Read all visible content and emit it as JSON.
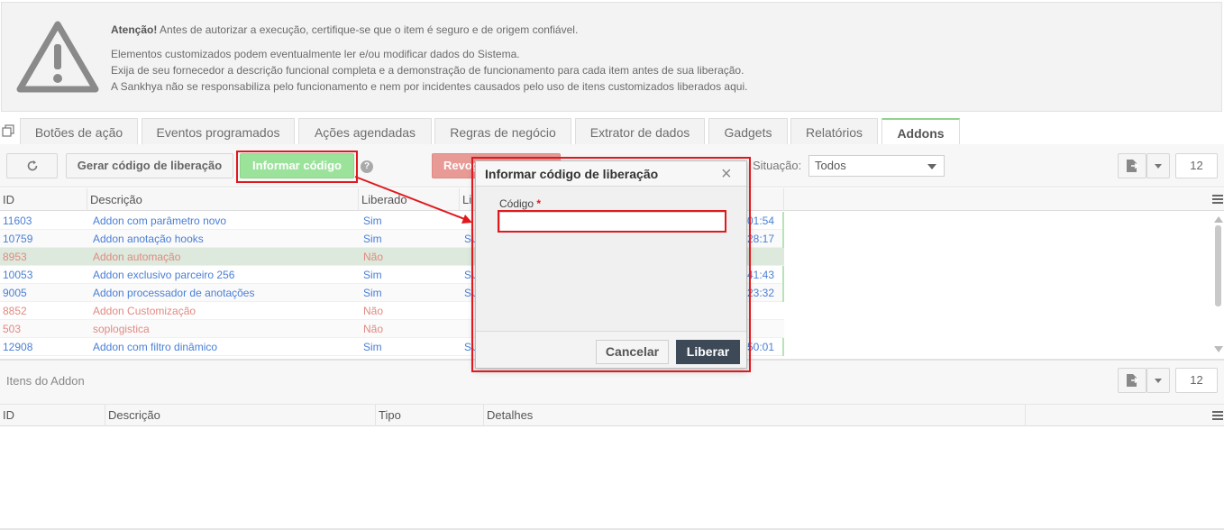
{
  "warning": {
    "bold": "Atenção!",
    "line1": " Antes de autorizar a execução, certifique-se que o item é seguro e de origem confiável.",
    "line2": "Elementos customizados podem eventualmente ler e/ou modificar dados do Sistema.",
    "line3": "Exija de seu fornecedor a descrição funcional completa e a demonstração de funcionamento para cada item antes de sua liberação.",
    "line4": "A Sankhya não se responsabiliza pelo funcionamento e nem por incidentes causados pelo uso de itens customizados liberados aqui."
  },
  "tabs": [
    {
      "label": "Botões de ação"
    },
    {
      "label": "Eventos programados"
    },
    {
      "label": "Ações agendadas"
    },
    {
      "label": "Regras de negócio"
    },
    {
      "label": "Extrator de dados"
    },
    {
      "label": "Gadgets"
    },
    {
      "label": "Relatórios"
    },
    {
      "label": "Addons"
    }
  ],
  "toolbar": {
    "gerar_label": "Gerar código de liberação",
    "informar_label": "Informar código",
    "revogar_label": "Revogar",
    "help": "?",
    "situacao_label": "Situação:",
    "situacao_value": "Todos",
    "page_size": "12"
  },
  "grid": {
    "headers": {
      "id": "ID",
      "descricao": "Descrição",
      "liberado": "Liberado",
      "liberado2": "Li"
    },
    "rows": [
      {
        "id": "11603",
        "desc": "Addon com parâmetro novo",
        "lib": "Sim",
        "lib2": "",
        "time": "01:54"
      },
      {
        "id": "10759",
        "desc": "Addon anotação hooks",
        "lib": "Sim",
        "lib2": "SU",
        "time": "28:17"
      },
      {
        "id": "8953",
        "desc": "Addon automação",
        "lib": "Não",
        "lib2": "",
        "time": ""
      },
      {
        "id": "10053",
        "desc": "Addon exclusivo parceiro 256",
        "lib": "Sim",
        "lib2": "SU",
        "time": "41:43"
      },
      {
        "id": "9005",
        "desc": "Addon processador de anotações",
        "lib": "Sim",
        "lib2": "SU",
        "time": "23:32"
      },
      {
        "id": "8852",
        "desc": "Addon Customização",
        "lib": "Não",
        "lib2": "",
        "time": ""
      },
      {
        "id": "503",
        "desc": "soplogistica",
        "lib": "Não",
        "lib2": "",
        "time": ""
      },
      {
        "id": "12908",
        "desc": "Addon com filtro dinâmico",
        "lib": "Sim",
        "lib2": "SU",
        "time": "50:01"
      }
    ]
  },
  "items": {
    "title": "Itens do Addon",
    "page_size": "12",
    "headers": {
      "id": "ID",
      "descricao": "Descrição",
      "tipo": "Tipo",
      "detalhes": "Detalhes"
    }
  },
  "modal": {
    "title": "Informar código de liberação",
    "close": "×",
    "field_label": "Código",
    "required_mark": "*",
    "field_value": "",
    "cancel_label": "Cancelar",
    "liberar_label": "Liberar"
  },
  "colors": {
    "green_button": "#9be39b",
    "red_button": "#e89a96",
    "highlight": "#e0191e",
    "link_blue": "#4a7fd6",
    "disabled_red": "#e08a82"
  }
}
